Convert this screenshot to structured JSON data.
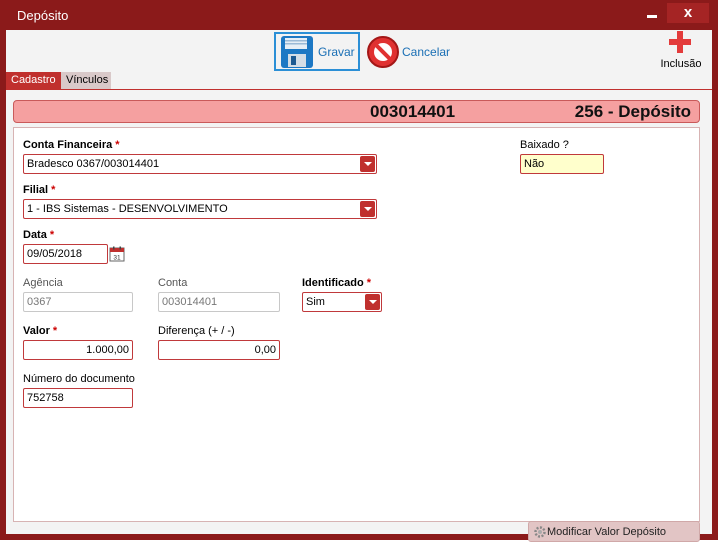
{
  "window": {
    "title": "Depósito",
    "close_glyph": "x"
  },
  "toolbar": {
    "gravar_label": "Gravar",
    "cancelar_label": "Cancelar",
    "inclusao_label": "Inclusão"
  },
  "tabs": [
    {
      "label": "Cadastro",
      "active": true
    },
    {
      "label": "Vínculos",
      "active": false
    }
  ],
  "header": {
    "numero": "003014401",
    "tipo": "256 - Depósito"
  },
  "form": {
    "conta_financeira": {
      "label": "Conta Financeira",
      "required_mark": "*",
      "value": "Bradesco 0367/003014401"
    },
    "baixado": {
      "label": "Baixado ?",
      "value": "Não"
    },
    "filial": {
      "label": "Filial",
      "required_mark": "*",
      "value": "1 - IBS Sistemas - DESENVOLVIMENTO"
    },
    "data": {
      "label": "Data",
      "required_mark": "*",
      "value": "09/05/2018"
    },
    "agencia": {
      "label": "Agência",
      "value": "0367"
    },
    "conta": {
      "label": "Conta",
      "value": "003014401"
    },
    "identificado": {
      "label": "Identificado",
      "required_mark": "*",
      "value": "Sim"
    },
    "valor": {
      "label": "Valor",
      "required_mark": "*",
      "value": "1.000,00"
    },
    "diferenca": {
      "label": "Diferença (+ / -)",
      "value": "0,00"
    },
    "numero_documento": {
      "label": "Número do documento",
      "value": "752758"
    },
    "modificar_label": "Modificar Valor Depósito"
  },
  "colors": {
    "titlebar": "#8b1a1a",
    "accent": "#c0302e",
    "header_bg": "#f5a0a0"
  }
}
